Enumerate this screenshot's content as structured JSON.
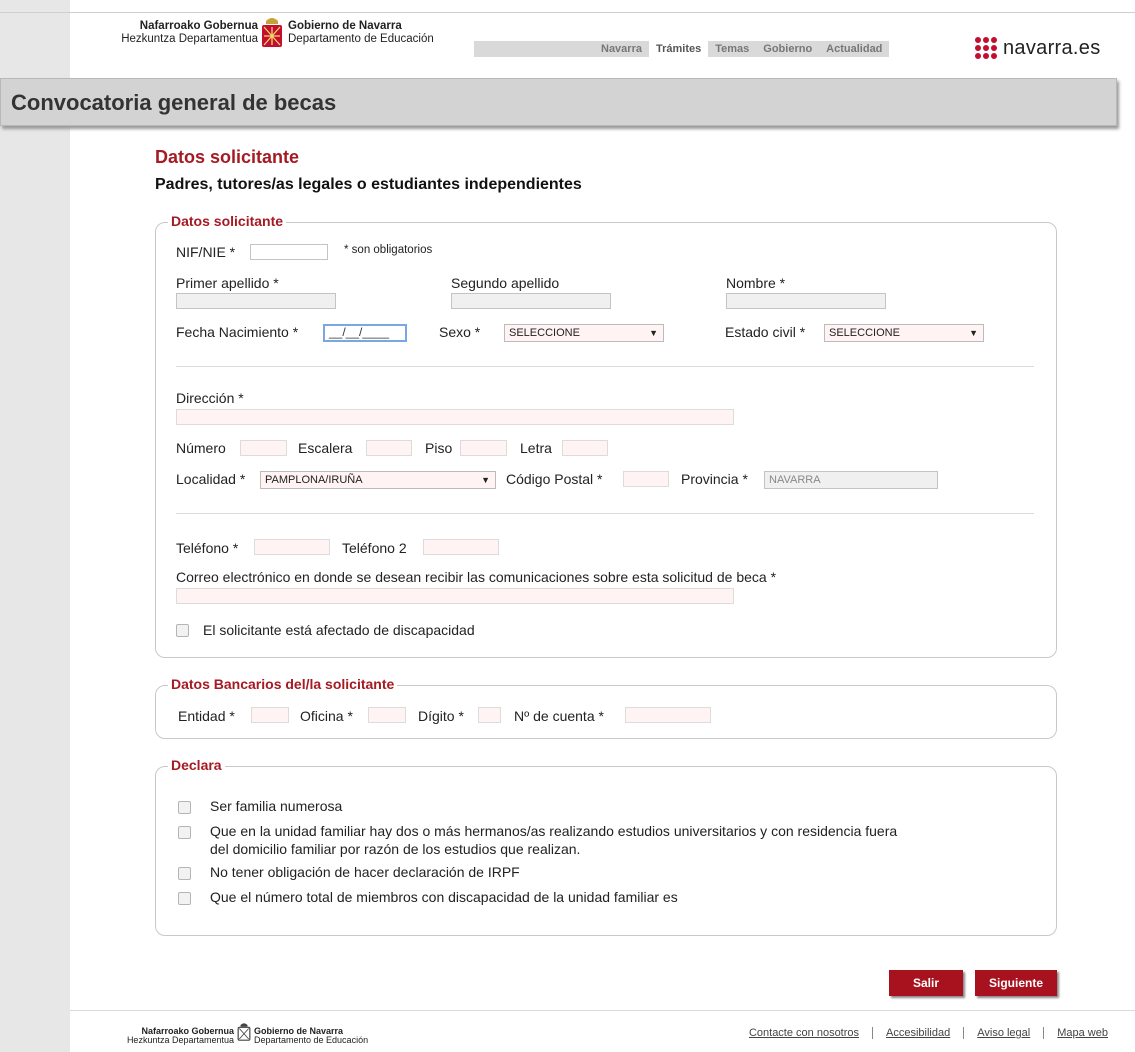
{
  "header": {
    "logo_eu_line1": "Nafarroako Gobernua",
    "logo_eu_line2": "Hezkuntza Departamentua",
    "logo_es_line1": "Gobierno de Navarra",
    "logo_es_line2": "Departamento de Educación",
    "nav": [
      "Navarra",
      "Trámites",
      "Temas",
      "Gobierno",
      "Actualidad"
    ],
    "nav_active": "Trámites",
    "brand": "navarra.es",
    "brand_color": "#c20f2f"
  },
  "page_title": "Convocatoria general de becas",
  "section": {
    "title": "Datos solicitante",
    "subtitle": "Padres, tutores/as legales o estudiantes independientes"
  },
  "applicant": {
    "legend": "Datos solicitante",
    "nif_label": "NIF/NIE *",
    "required_note": "* son obligatorios",
    "apellido1_label": "Primer apellido *",
    "apellido2_label": "Segundo apellido",
    "nombre_label": "Nombre *",
    "fecha_label": "Fecha Nacimiento *",
    "fecha_value": "__/__/____",
    "sexo_label": "Sexo *",
    "sexo_value": "SELECCIONE",
    "estado_label": "Estado civil *",
    "estado_value": "SELECCIONE",
    "direccion_label": "Dirección *",
    "numero_label": "Número",
    "escalera_label": "Escalera",
    "piso_label": "Piso",
    "letra_label": "Letra",
    "localidad_label": "Localidad *",
    "localidad_value": "PAMPLONA/IRUÑA",
    "cp_label": "Código Postal *",
    "provincia_label": "Provincia *",
    "provincia_value": "NAVARRA",
    "telefono_label": "Teléfono *",
    "telefono2_label": "Teléfono 2",
    "email_label": "Correo electrónico en donde se desean recibir las comunicaciones sobre esta solicitud de beca *",
    "discapacidad_label": "El solicitante está afectado de discapacidad"
  },
  "bank": {
    "legend": "Datos Bancarios del/la solicitante",
    "entidad_label": "Entidad *",
    "oficina_label": "Oficina *",
    "digito_label": "Dígito *",
    "cuenta_label": "Nº de cuenta *"
  },
  "declara": {
    "legend": "Declara",
    "items": [
      "Ser familia numerosa",
      "Que en la unidad familiar hay dos o más hermanos/as realizando estudios universitarios y con residencia fuera",
      "del domicilio familiar por razón de los estudios que realizan.",
      "No tener obligación de hacer declaración de IRPF",
      "Que el número total de miembros con discapacidad de la unidad familiar es"
    ]
  },
  "buttons": {
    "salir": "Salir",
    "siguiente": "Siguiente"
  },
  "footer": {
    "links": [
      "Contacte con nosotros",
      "Accesibilidad",
      "Aviso legal",
      "Mapa web"
    ]
  },
  "colors": {
    "accent": "#a51a23",
    "button": "#a8121f"
  }
}
